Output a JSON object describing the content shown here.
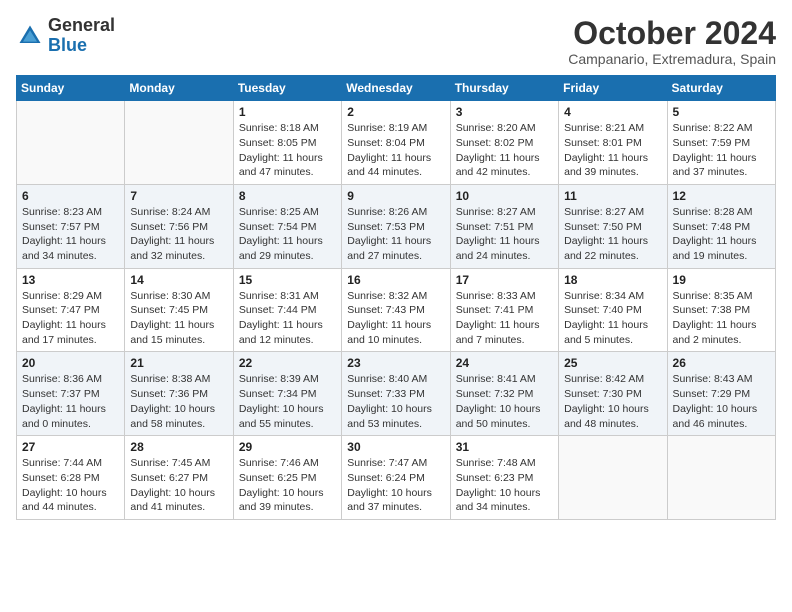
{
  "header": {
    "logo_line1": "General",
    "logo_line2": "Blue",
    "title": "October 2024",
    "subtitle": "Campanario, Extremadura, Spain"
  },
  "weekdays": [
    "Sunday",
    "Monday",
    "Tuesday",
    "Wednesday",
    "Thursday",
    "Friday",
    "Saturday"
  ],
  "weeks": [
    [
      {
        "day": "",
        "info": ""
      },
      {
        "day": "",
        "info": ""
      },
      {
        "day": "1",
        "info": "Sunrise: 8:18 AM\nSunset: 8:05 PM\nDaylight: 11 hours and 47 minutes."
      },
      {
        "day": "2",
        "info": "Sunrise: 8:19 AM\nSunset: 8:04 PM\nDaylight: 11 hours and 44 minutes."
      },
      {
        "day": "3",
        "info": "Sunrise: 8:20 AM\nSunset: 8:02 PM\nDaylight: 11 hours and 42 minutes."
      },
      {
        "day": "4",
        "info": "Sunrise: 8:21 AM\nSunset: 8:01 PM\nDaylight: 11 hours and 39 minutes."
      },
      {
        "day": "5",
        "info": "Sunrise: 8:22 AM\nSunset: 7:59 PM\nDaylight: 11 hours and 37 minutes."
      }
    ],
    [
      {
        "day": "6",
        "info": "Sunrise: 8:23 AM\nSunset: 7:57 PM\nDaylight: 11 hours and 34 minutes."
      },
      {
        "day": "7",
        "info": "Sunrise: 8:24 AM\nSunset: 7:56 PM\nDaylight: 11 hours and 32 minutes."
      },
      {
        "day": "8",
        "info": "Sunrise: 8:25 AM\nSunset: 7:54 PM\nDaylight: 11 hours and 29 minutes."
      },
      {
        "day": "9",
        "info": "Sunrise: 8:26 AM\nSunset: 7:53 PM\nDaylight: 11 hours and 27 minutes."
      },
      {
        "day": "10",
        "info": "Sunrise: 8:27 AM\nSunset: 7:51 PM\nDaylight: 11 hours and 24 minutes."
      },
      {
        "day": "11",
        "info": "Sunrise: 8:27 AM\nSunset: 7:50 PM\nDaylight: 11 hours and 22 minutes."
      },
      {
        "day": "12",
        "info": "Sunrise: 8:28 AM\nSunset: 7:48 PM\nDaylight: 11 hours and 19 minutes."
      }
    ],
    [
      {
        "day": "13",
        "info": "Sunrise: 8:29 AM\nSunset: 7:47 PM\nDaylight: 11 hours and 17 minutes."
      },
      {
        "day": "14",
        "info": "Sunrise: 8:30 AM\nSunset: 7:45 PM\nDaylight: 11 hours and 15 minutes."
      },
      {
        "day": "15",
        "info": "Sunrise: 8:31 AM\nSunset: 7:44 PM\nDaylight: 11 hours and 12 minutes."
      },
      {
        "day": "16",
        "info": "Sunrise: 8:32 AM\nSunset: 7:43 PM\nDaylight: 11 hours and 10 minutes."
      },
      {
        "day": "17",
        "info": "Sunrise: 8:33 AM\nSunset: 7:41 PM\nDaylight: 11 hours and 7 minutes."
      },
      {
        "day": "18",
        "info": "Sunrise: 8:34 AM\nSunset: 7:40 PM\nDaylight: 11 hours and 5 minutes."
      },
      {
        "day": "19",
        "info": "Sunrise: 8:35 AM\nSunset: 7:38 PM\nDaylight: 11 hours and 2 minutes."
      }
    ],
    [
      {
        "day": "20",
        "info": "Sunrise: 8:36 AM\nSunset: 7:37 PM\nDaylight: 11 hours and 0 minutes."
      },
      {
        "day": "21",
        "info": "Sunrise: 8:38 AM\nSunset: 7:36 PM\nDaylight: 10 hours and 58 minutes."
      },
      {
        "day": "22",
        "info": "Sunrise: 8:39 AM\nSunset: 7:34 PM\nDaylight: 10 hours and 55 minutes."
      },
      {
        "day": "23",
        "info": "Sunrise: 8:40 AM\nSunset: 7:33 PM\nDaylight: 10 hours and 53 minutes."
      },
      {
        "day": "24",
        "info": "Sunrise: 8:41 AM\nSunset: 7:32 PM\nDaylight: 10 hours and 50 minutes."
      },
      {
        "day": "25",
        "info": "Sunrise: 8:42 AM\nSunset: 7:30 PM\nDaylight: 10 hours and 48 minutes."
      },
      {
        "day": "26",
        "info": "Sunrise: 8:43 AM\nSunset: 7:29 PM\nDaylight: 10 hours and 46 minutes."
      }
    ],
    [
      {
        "day": "27",
        "info": "Sunrise: 7:44 AM\nSunset: 6:28 PM\nDaylight: 10 hours and 44 minutes."
      },
      {
        "day": "28",
        "info": "Sunrise: 7:45 AM\nSunset: 6:27 PM\nDaylight: 10 hours and 41 minutes."
      },
      {
        "day": "29",
        "info": "Sunrise: 7:46 AM\nSunset: 6:25 PM\nDaylight: 10 hours and 39 minutes."
      },
      {
        "day": "30",
        "info": "Sunrise: 7:47 AM\nSunset: 6:24 PM\nDaylight: 10 hours and 37 minutes."
      },
      {
        "day": "31",
        "info": "Sunrise: 7:48 AM\nSunset: 6:23 PM\nDaylight: 10 hours and 34 minutes."
      },
      {
        "day": "",
        "info": ""
      },
      {
        "day": "",
        "info": ""
      }
    ]
  ]
}
